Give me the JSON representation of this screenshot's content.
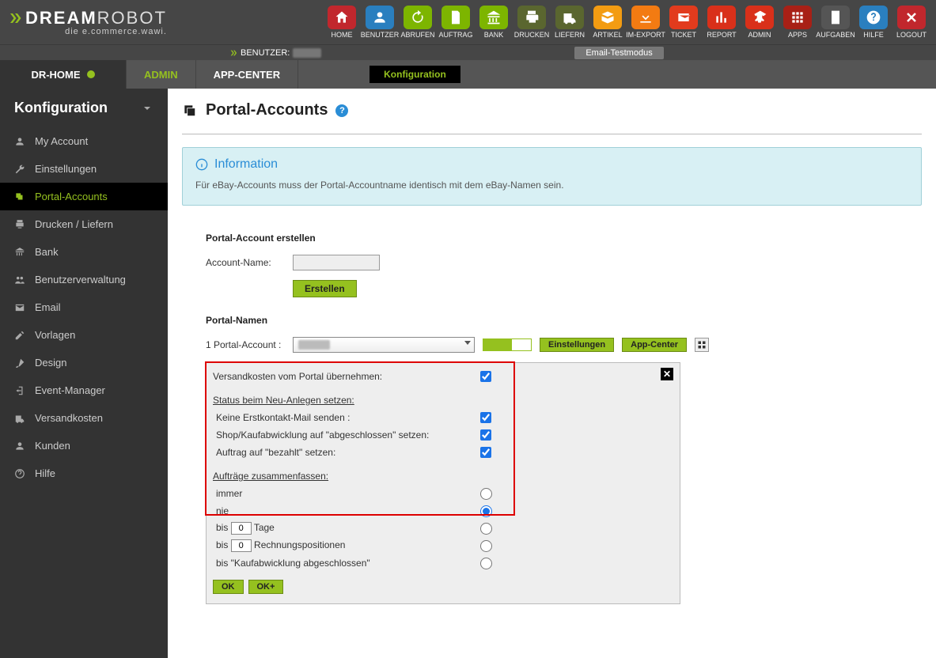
{
  "brand": {
    "main": "DREAM",
    "main2": "ROBOT",
    "sub": "die e.commerce.wawi."
  },
  "topIcons": [
    {
      "name": "home",
      "label": "HOME",
      "color": "#c1272d"
    },
    {
      "name": "user",
      "label": "BENUTZER",
      "color": "#2a7fbf"
    },
    {
      "name": "refresh",
      "label": "ABRUFEN",
      "color": "#7db500"
    },
    {
      "name": "order",
      "label": "AUFTRAG",
      "color": "#7db500"
    },
    {
      "name": "bank",
      "label": "BANK",
      "color": "#7db500"
    },
    {
      "name": "print",
      "label": "DRUCKEN",
      "color": "#5a662f"
    },
    {
      "name": "ship",
      "label": "LIEFERN",
      "color": "#5a662f"
    },
    {
      "name": "article",
      "label": "ARTIKEL",
      "color": "#f39c12"
    },
    {
      "name": "import",
      "label": "IM-EXPORT",
      "color": "#f37b12"
    },
    {
      "name": "ticket",
      "label": "TICKET",
      "color": "#e23b1d"
    },
    {
      "name": "report",
      "label": "REPORT",
      "color": "#d9301a"
    },
    {
      "name": "admin",
      "label": "ADMIN",
      "color": "#d9301a"
    },
    {
      "name": "apps",
      "label": "APPS",
      "color": "#a82016"
    },
    {
      "name": "tasks",
      "label": "AUFGABEN",
      "color": "#555"
    },
    {
      "name": "help",
      "label": "HILFE",
      "color": "#2a7fbf"
    },
    {
      "name": "logout",
      "label": "LOGOUT",
      "color": "#c1272d"
    }
  ],
  "subbar": {
    "userLabel": "BENUTZER:",
    "badge": "Email-Testmodus"
  },
  "nav": {
    "drhome": "DR-HOME",
    "admin": "ADMIN",
    "appcenter": "APP-CENTER",
    "config": "Konfiguration"
  },
  "sidebar": {
    "header": "Konfiguration",
    "items": [
      {
        "label": "My Account",
        "icon": "user"
      },
      {
        "label": "Einstellungen",
        "icon": "wrench"
      },
      {
        "label": "Portal-Accounts",
        "icon": "layers"
      },
      {
        "label": "Drucken / Liefern",
        "icon": "print"
      },
      {
        "label": "Bank",
        "icon": "bank"
      },
      {
        "label": "Benutzerverwaltung",
        "icon": "users"
      },
      {
        "label": "Email",
        "icon": "mail"
      },
      {
        "label": "Vorlagen",
        "icon": "edit"
      },
      {
        "label": "Design",
        "icon": "brush"
      },
      {
        "label": "Event-Manager",
        "icon": "exit"
      },
      {
        "label": "Versandkosten",
        "icon": "truck"
      },
      {
        "label": "Kunden",
        "icon": "person"
      },
      {
        "label": "Hilfe",
        "icon": "help"
      }
    ],
    "activeIndex": 2
  },
  "page": {
    "title": "Portal-Accounts",
    "info": {
      "heading": "Information",
      "body": "Für eBay-Accounts muss der Portal-Accountname identisch mit dem eBay-Namen sein."
    },
    "create": {
      "heading": "Portal-Account erstellen",
      "nameLabel": "Account-Name:",
      "btn": "Erstellen"
    },
    "names": {
      "heading": "Portal-Namen",
      "countLabel": "1 Portal-Account :",
      "settingsBtn": "Einstellungen",
      "appBtn": "App-Center"
    },
    "panel": {
      "row1": "Versandkosten vom Portal übernehmen:",
      "hdr1": "Status beim Neu-Anlegen setzen:",
      "r2": "Keine Erstkontakt-Mail senden :",
      "r3": "Shop/Kaufabwicklung auf \"abgeschlossen\" setzen:",
      "r4": "Auftrag auf \"bezahlt\" setzen:",
      "hdr2": "Aufträge zusammenfassen:",
      "r5": "immer",
      "r6": "nie",
      "r7a": "bis",
      "r7b": "Tage",
      "r7v": "0",
      "r8a": "bis",
      "r8b": "Rechnungspositionen",
      "r8v": "0",
      "r9": "bis \"Kaufabwicklung abgeschlossen\"",
      "ok": "OK",
      "okp": "OK+"
    }
  }
}
